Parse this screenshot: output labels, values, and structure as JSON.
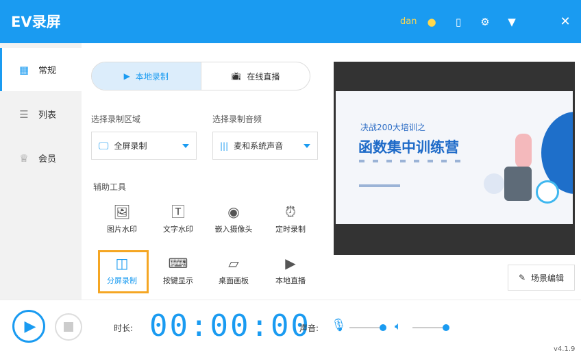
{
  "app": {
    "title": "EV录屏",
    "user": "dan",
    "version": "v4.1.9"
  },
  "header_icons": [
    "coin-icon",
    "phone-icon",
    "gear-icon",
    "menu-icon",
    "close-icon"
  ],
  "sidebar": {
    "items": [
      {
        "label": "常规",
        "icon": "grid-icon"
      },
      {
        "label": "列表",
        "icon": "list-icon"
      },
      {
        "label": "会员",
        "icon": "crown-icon"
      }
    ]
  },
  "tabs": [
    {
      "label": "本地录制"
    },
    {
      "label": "在线直播"
    }
  ],
  "region": {
    "label": "选择录制区域",
    "value": "全屏录制"
  },
  "audio": {
    "label": "选择录制音频",
    "value": "麦和系统声音"
  },
  "tools": {
    "label": "辅助工具",
    "items": [
      {
        "label": "图片水印",
        "icon": "image-icon"
      },
      {
        "label": "文字水印",
        "icon": "text-icon"
      },
      {
        "label": "嵌入摄像头",
        "icon": "camera-icon"
      },
      {
        "label": "定时录制",
        "icon": "alarm-icon"
      },
      {
        "label": "分屏录制",
        "icon": "split-screen-icon"
      },
      {
        "label": "按键显示",
        "icon": "keyboard-icon"
      },
      {
        "label": "桌面画板",
        "icon": "easel-icon"
      },
      {
        "label": "本地直播",
        "icon": "live-icon"
      }
    ]
  },
  "preview": {
    "subtitle": "决战200大培训之",
    "headline": "函数集中训练营"
  },
  "scene_edit": "场景编辑",
  "timer": {
    "label": "时长:",
    "value": "00:00:00",
    "h": "00",
    "m": "00",
    "s": "00"
  },
  "sound": {
    "label": "声音:",
    "mic_level": 100,
    "speaker_level": 100
  }
}
